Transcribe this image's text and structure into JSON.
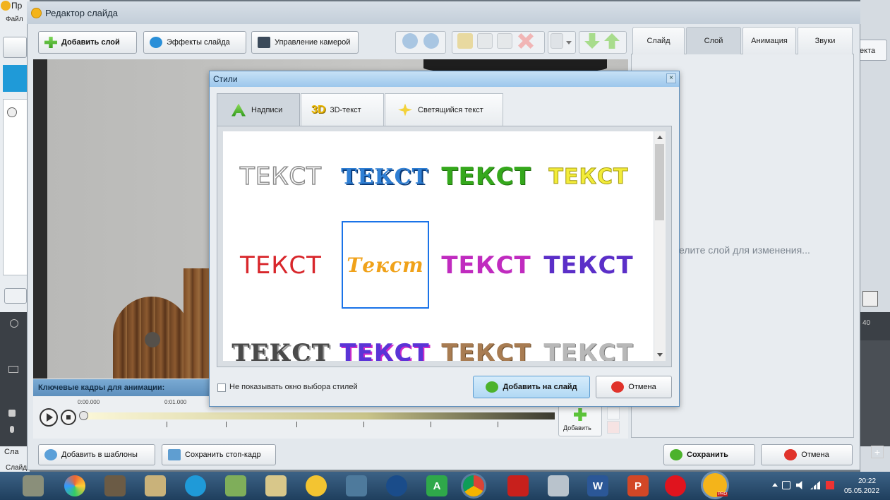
{
  "window": {
    "title": "Редактор слайда",
    "bg_title_fragment": "Пр",
    "bg_menu_fragment": "Файл",
    "right_btn_fragment": "екта",
    "status_fragment": "Слайд",
    "left_btn_fragment": "Сла",
    "ruler_fragment": "40"
  },
  "toolbar": {
    "add_layer": "Добавить слой",
    "slide_effects": "Эффекты слайда",
    "camera_control": "Управление камерой"
  },
  "right_tabs": [
    "Слайд",
    "Слой",
    "Анимация",
    "Звуки"
  ],
  "right_panel": {
    "hint": "елите слой для изменения..."
  },
  "dialog": {
    "title": "Стили",
    "tabs": [
      {
        "label": "Надписи",
        "icon": "letter-a-icon"
      },
      {
        "label": "3D-текст",
        "icon": "3d-icon",
        "badge": "3D"
      },
      {
        "label": "Светящийся текст",
        "icon": "sparkle-icon"
      }
    ],
    "samples": [
      "ТЕКСТ",
      "ТЕКСТ",
      "ТЕКСТ",
      "ТЕКСТ",
      "ТЕКСТ",
      "Текст",
      "ТЕКСТ",
      "ТЕКСТ",
      "ТЕКСТ",
      "ТЕКСТ",
      "ТЕКСТ",
      "ТЕКСТ"
    ],
    "checkbox_label": "Не показывать окно выбора стилей",
    "add_btn": "Добавить на слайд",
    "cancel_btn": "Отмена"
  },
  "keyframes": {
    "title": "Ключевые кадры для анимации:",
    "times": [
      "0:00.000",
      "0:01.000"
    ],
    "add_label": "Добавить"
  },
  "bottom": {
    "add_templates": "Добавить в шаблоны",
    "save_frame": "Сохранить стоп-кадр",
    "save": "Сохранить",
    "cancel": "Отмена"
  },
  "taskbar": {
    "time": "20:22",
    "date": "05.05.2022",
    "pro_badge": "PRO",
    "word_letter": "W",
    "ppt_letter": "P",
    "store_letter": "A"
  },
  "colors": {
    "accent": "#1a73e8",
    "titlebar": "#c9d3dd",
    "dialog_title": "#aad0f0"
  }
}
